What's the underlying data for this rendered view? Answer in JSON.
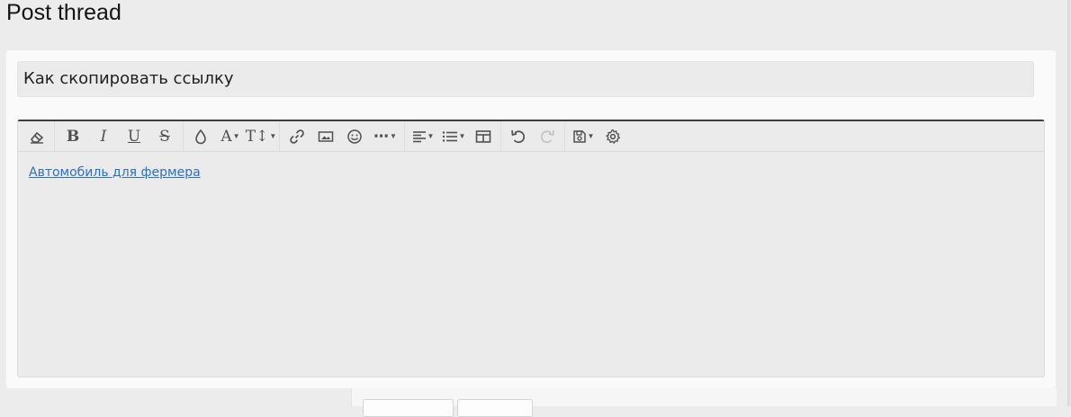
{
  "page": {
    "title": "Post thread"
  },
  "form": {
    "title_value": "Как скопировать ссылку"
  },
  "toolbar": {
    "buttons": [
      {
        "icon": "remove-format-icon"
      },
      {
        "icon": "bold-icon",
        "label": "B"
      },
      {
        "icon": "italic-icon",
        "label": "I"
      },
      {
        "icon": "underline-icon",
        "label": "U"
      },
      {
        "icon": "strikethrough-icon",
        "label": "S"
      },
      {
        "icon": "text-color-icon"
      },
      {
        "icon": "font-family-icon",
        "label": "A"
      },
      {
        "icon": "font-size-icon",
        "label": "T↕"
      },
      {
        "icon": "link-icon"
      },
      {
        "icon": "image-icon"
      },
      {
        "icon": "smilie-icon"
      },
      {
        "icon": "more-options-icon",
        "label": "⋯"
      },
      {
        "icon": "align-icon"
      },
      {
        "icon": "list-icon"
      },
      {
        "icon": "table-icon"
      },
      {
        "icon": "undo-icon"
      },
      {
        "icon": "redo-icon"
      },
      {
        "icon": "drafts-icon"
      },
      {
        "icon": "settings-icon"
      }
    ]
  },
  "editor": {
    "content_link": "Автомобиль для фермера"
  },
  "colors": {
    "accent_link": "#2d6fca",
    "editor_border_top": "#3d3d3d",
    "background": "#ececec"
  }
}
